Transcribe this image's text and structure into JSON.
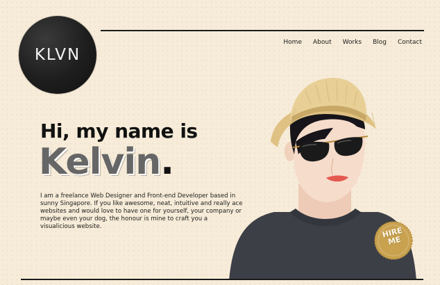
{
  "logo": {
    "text": "KLVN"
  },
  "nav": {
    "items": [
      {
        "label": "Home"
      },
      {
        "label": "About"
      },
      {
        "label": "Works"
      },
      {
        "label": "Blog"
      },
      {
        "label": "Contact"
      }
    ]
  },
  "hero": {
    "greeting": "Hi, my name is",
    "name": "Kelvin",
    "name_punct": ".",
    "bio": "I am a freelance Web Designer and Front-end Developer based in sunny Singapore. If you like awesome, neat, intuitive and really ace websites and would love to have one for yourself, your company or maybe even your dog, the honour is mine to craft you a visualicious website."
  },
  "hire_badge": {
    "line1": "HIRE",
    "line2": "ME"
  },
  "colors": {
    "background": "#f7ecd9",
    "logo": "#1e1e1e",
    "name_text": "#666666",
    "badge": "#c9a24f",
    "shirt": "#3d3f47",
    "skin": "#f6dccb",
    "hat": "#e4c98b"
  }
}
